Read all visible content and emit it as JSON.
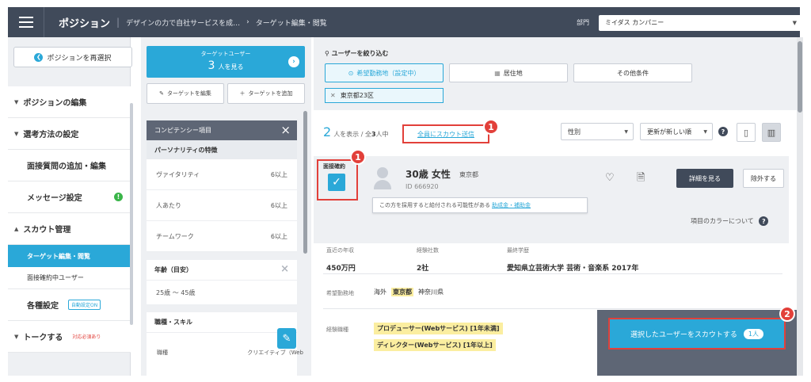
{
  "header": {
    "title": "ポジション",
    "breadcrumb": "デザインの力で自社サービスを成…",
    "breadcrumb_arrow": "›",
    "current": "ターゲット編集・閲覧",
    "dept_label": "部門",
    "dept_value": "ミイダス カンパニー"
  },
  "sidebar": {
    "reselect_label": "ポジションを再選択",
    "items": [
      {
        "label": "ポジションの編集"
      },
      {
        "label": "選考方法の設定"
      },
      {
        "label": "面接質問の追加・編集"
      },
      {
        "label": "メッセージ設定"
      },
      {
        "label": "スカウト管理"
      },
      {
        "label": "ターゲット編集・閲覧"
      },
      {
        "label": "面接確約中ユーザー"
      },
      {
        "label": "各種設定"
      },
      {
        "label": "トークする"
      }
    ],
    "auto_badge": "自動設定ON",
    "talk_note": "対応必須あり",
    "green_badge": "!"
  },
  "middle": {
    "target_users_label": "ターゲットユーザー",
    "target_count": "3",
    "target_view_suffix": "人を見る",
    "edit_target": "ターゲットを編集",
    "add_target": "ターゲットを追加",
    "competency_head": "コンピテンシー項目",
    "personality_head": "パーソナリティの特徴",
    "competencies": [
      {
        "name": "ヴァイタリティ",
        "level": "6以上"
      },
      {
        "name": "人あたり",
        "level": "6以上"
      },
      {
        "name": "チームワーク",
        "level": "6以上"
      }
    ],
    "age_head": "年齢（目安）",
    "age_range": "25歳 〜 45歳",
    "skill_head": "職種・スキル",
    "cut_left": "職種",
    "cut_right": "クリエイティブ（Web"
  },
  "main": {
    "filter_title": "ユーザーを絞り込む",
    "filter_buttons": [
      "希望勤務地（設定中）",
      "居住地",
      "その他条件"
    ],
    "tag": "東京都23区",
    "result_count": "2",
    "result_mid": "人を表示 / 全",
    "result_total": "3",
    "result_suffix": "人中",
    "scout_all": "全員にスカウト送信",
    "sort_gender": "性別",
    "sort_order": "更新が新しい順",
    "candidate": {
      "interview_label": "面接確約",
      "name": "30歳 女性",
      "location": "東京都",
      "id": "ID 666920",
      "detail_btn": "詳細を見る",
      "exclude_btn": "除外する",
      "tooltip": "この方を採用すると給付される可能性がある",
      "tooltip_link": "助成金・補助金",
      "color_about": "項目のカラーについて"
    },
    "info": {
      "income_label": "直近の年収",
      "income": "450万円",
      "companies_label": "経験社数",
      "companies": "2社",
      "education_label": "最終学歴",
      "education": "愛知県立芸術大学 芸術・音楽系 2017年"
    },
    "wish_label": "希望勤務地",
    "wish_values": [
      "海外",
      "東京都",
      "神奈川県"
    ],
    "exp_label": "経験職種",
    "exp_tags": [
      "プロデューサー(Webサービス) [1年未満]",
      "ディレクター(Webサービス) [1年以上]"
    ],
    "scout_selected": "選択したユーザーをスカウトする",
    "scout_count": "1人"
  },
  "badges": [
    "1",
    "1",
    "2"
  ],
  "colors": {
    "accent": "#2aa8d8",
    "header": "#404a5a",
    "highlight": "#e2403a"
  }
}
